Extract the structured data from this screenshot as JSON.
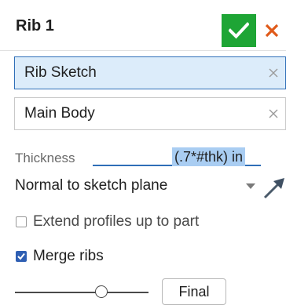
{
  "header": {
    "title": "Rib 1",
    "ok_color": "#1ea535",
    "cancel_color": "#e05a1a"
  },
  "fields": {
    "sketch": {
      "label": "Rib Sketch",
      "selected": true
    },
    "body": {
      "label": "Main Body",
      "selected": false
    }
  },
  "thickness": {
    "label": "Thickness",
    "value": "(.7*#thk) in"
  },
  "direction": {
    "selected": "Normal to sketch plane"
  },
  "options": {
    "extend": {
      "label": "Extend profiles up to part",
      "checked": false
    },
    "merge": {
      "label": "Merge ribs",
      "checked": true
    }
  },
  "rollback": {
    "final_label": "Final"
  },
  "icons": {
    "ok": "checkmark-icon",
    "cancel": "close-icon",
    "clear": "clear-x-icon",
    "caret": "caret-down-icon",
    "flip": "direction-arrow-icon"
  }
}
